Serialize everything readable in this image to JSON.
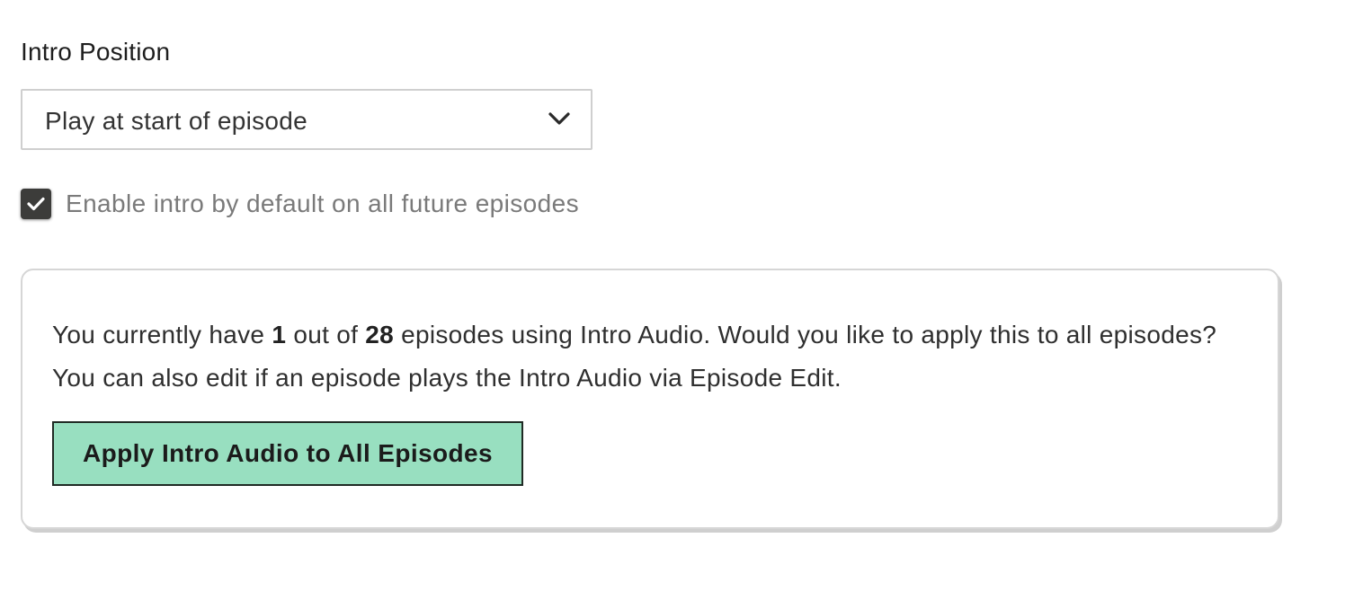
{
  "intro_position": {
    "label": "Intro Position",
    "selected_value": "Play at start of episode",
    "dropdown_icon": "chevron-down-icon"
  },
  "default_toggle": {
    "checked": true,
    "label": "Enable intro by default on all future episodes",
    "check_icon": "checkmark-icon"
  },
  "apply_panel": {
    "text_before_count": "You currently have ",
    "episodes_using": "1",
    "text_between": " out of ",
    "total_episodes": "28",
    "text_after_count": " episodes using Intro Audio. Would you like to apply this to all episodes? You can also edit if an episode plays the Intro Audio via Episode Edit.",
    "button_label": "Apply Intro Audio to All Episodes"
  },
  "colors": {
    "button_background": "#98dfc0",
    "checkbox_fill": "#3c3c3a",
    "panel_border": "#d6d6d6"
  }
}
